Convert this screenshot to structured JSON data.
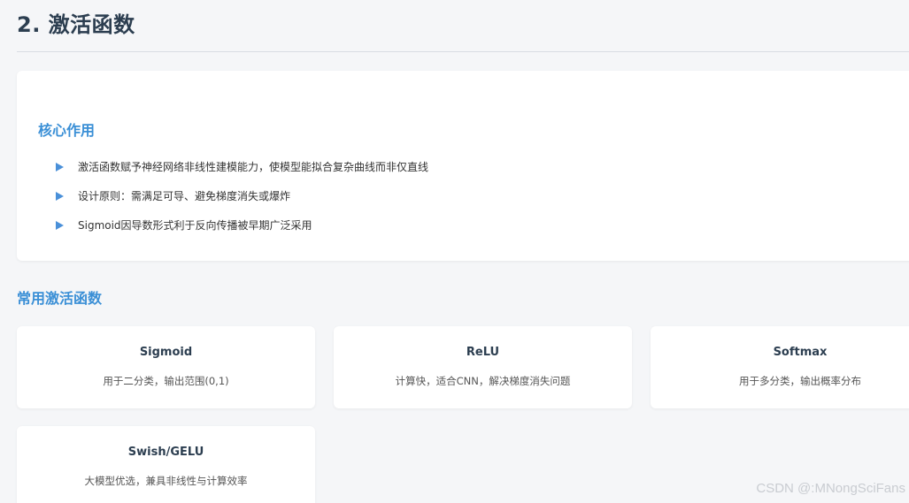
{
  "page": {
    "title": "2. 激活函数"
  },
  "core": {
    "heading": "核心作用",
    "bullets": [
      "激活函数赋予神经网络非线性建模能力，使模型能拟合复杂曲线而非仅直线",
      "设计原则：需满足可导、避免梯度消失或爆炸",
      "Sigmoid因导数形式利于反向传播被早期广泛采用"
    ]
  },
  "functions": {
    "heading": "常用激活函数",
    "items": [
      {
        "name": "Sigmoid",
        "desc": "用于二分类，输出范围(0,1)"
      },
      {
        "name": "ReLU",
        "desc": "计算快，适合CNN，解决梯度消失问题"
      },
      {
        "name": "Softmax",
        "desc": "用于多分类，输出概率分布"
      },
      {
        "name": "Swish/GELU",
        "desc": "大模型优选，兼具非线性与计算效率"
      }
    ]
  },
  "watermark": "CSDN @:MNongSciFans",
  "colors": {
    "accent": "#3a8fd6",
    "bullet": "#4a90d9",
    "background": "#f5f6f8",
    "card": "#ffffff"
  }
}
